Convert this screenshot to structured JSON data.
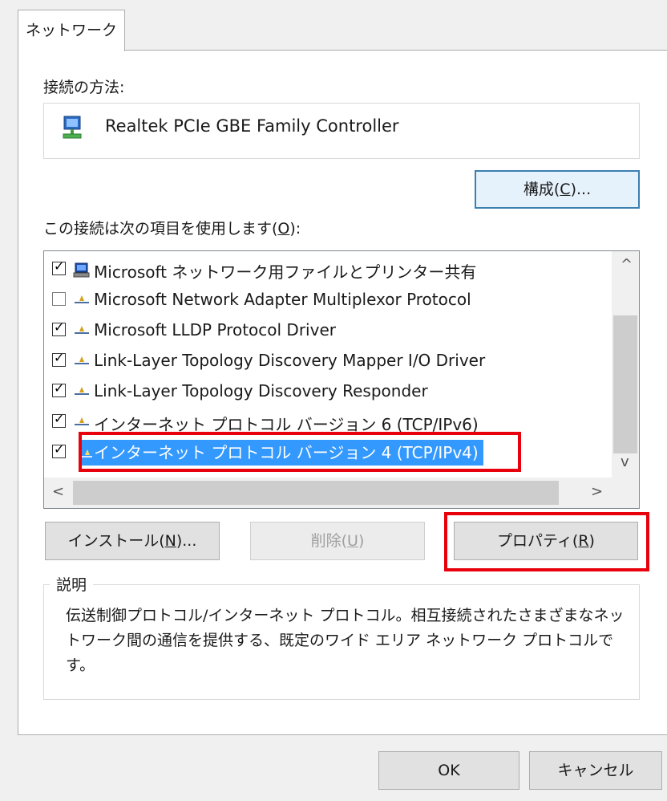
{
  "tab": {
    "label": "ネットワーク"
  },
  "connect_using": {
    "label": "接続の方法:",
    "adapter_name": "Realtek PCIe GBE Family Controller",
    "configure_button": {
      "text": "構成(",
      "key": "C",
      "suffix": ")..."
    }
  },
  "items_section": {
    "label_prefix": "この接続は次の項目を使用します(",
    "label_key": "O",
    "label_suffix": "):",
    "items": [
      {
        "label": "Microsoft ネットワーク用ファイルとプリンター共有",
        "checked": true,
        "icon": "network-share-icon"
      },
      {
        "label": "Microsoft Network Adapter Multiplexor Protocol",
        "checked": false,
        "icon": "protocol-icon"
      },
      {
        "label": "Microsoft LLDP Protocol Driver",
        "checked": true,
        "icon": "protocol-icon"
      },
      {
        "label": "Link-Layer Topology Discovery Mapper I/O Driver",
        "checked": true,
        "icon": "protocol-icon"
      },
      {
        "label": "Link-Layer Topology Discovery Responder",
        "checked": true,
        "icon": "protocol-icon"
      },
      {
        "label": "インターネット プロトコル バージョン 6 (TCP/IPv6)",
        "checked": true,
        "icon": "protocol-icon"
      },
      {
        "label": "インターネット プロトコル バージョン 4 (TCP/IPv4)",
        "checked": true,
        "icon": "protocol-icon",
        "selected": true
      }
    ],
    "scroll_up": "^",
    "scroll_down": "v",
    "scroll_left": "<",
    "scroll_right": ">"
  },
  "buttons": {
    "install": {
      "text": "インストール(",
      "key": "N",
      "suffix": ")..."
    },
    "uninstall": {
      "text": "削除(",
      "key": "U",
      "suffix": ")"
    },
    "properties": {
      "text": "プロパティ(",
      "key": "R",
      "suffix": ")"
    }
  },
  "description": {
    "title": "説明",
    "text": "伝送制御プロトコル/インターネット プロトコル。相互接続されたさまざまなネットワーク間の通信を提供する、既定のワイド エリア ネットワーク プロトコルです。"
  },
  "footer": {
    "ok": "OK",
    "cancel": "キャンセル"
  },
  "colors": {
    "selection": "#3399ff",
    "highlight_box": "#e8000c",
    "focus_border": "#3c7fb1"
  }
}
